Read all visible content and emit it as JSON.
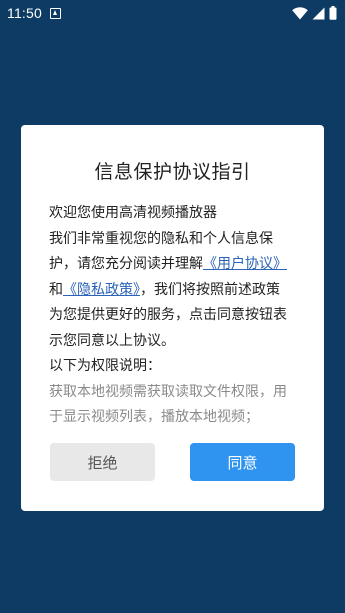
{
  "status_bar": {
    "time": "11:50",
    "icons": [
      "app-notification-icon",
      "wifi-icon",
      "cellular-signal-icon",
      "battery-icon"
    ]
  },
  "dialog": {
    "title": "信息保护协议指引",
    "welcome": "欢迎您使用高清视频播放器",
    "para_line1": "我们非常重视您的隐私和个人信息保",
    "para_line2_prefix": "护，请您充分阅读并理解",
    "user_agreement_link": "《用户协议》",
    "para_line3_prefix": "和",
    "privacy_policy_link": "《隐私政策》",
    "para_line3_suffix": "，我们将按照前述政策",
    "para_line4": "为您提供更好的服务，点击同意按钮表",
    "para_line5": "示您同意以上协议。",
    "permissions_heading": "以下为权限说明：",
    "permission_line1": "获取本地视频需获取读取文件权限，用",
    "permission_line2": "于显示视频列表，播放本地视频；",
    "reject_label": "拒绝",
    "agree_label": "同意"
  },
  "colors": {
    "background": "#0d3b63",
    "link": "#2a63b8",
    "agree_button": "#2f93f0",
    "reject_button": "#e8e8e8"
  }
}
